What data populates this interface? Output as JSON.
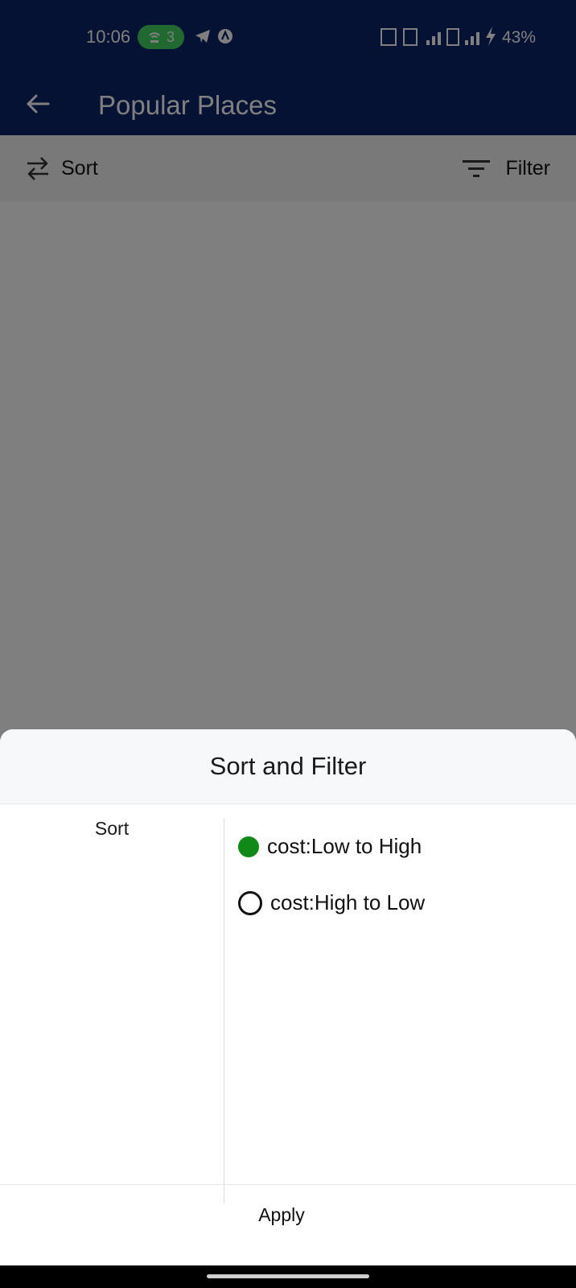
{
  "status_bar": {
    "time": "10:06",
    "hotspot_count": "3",
    "battery_label": "43%",
    "icons": [
      "hotspot-icon",
      "telegram-icon",
      "notification-icon",
      "network-signal-icon",
      "charging-icon"
    ]
  },
  "app_bar": {
    "title": "Popular Places",
    "back_icon": "arrow-left-icon",
    "background_color": "#0c2566"
  },
  "toolbar": {
    "sort_label": "Sort",
    "sort_icon": "swap-arrows-icon",
    "filter_label": "Filter",
    "filter_icon": "filter-lines-icon"
  },
  "sheet": {
    "title": "Sort and Filter",
    "sidebar": {
      "items": [
        {
          "label": "Sort",
          "selected": true
        }
      ]
    },
    "sort_options": [
      {
        "label": "cost:Low to High",
        "selected": true
      },
      {
        "label": "cost:High to Low",
        "selected": false
      }
    ],
    "apply_label": "Apply",
    "accent_color": "#0f8a17"
  }
}
